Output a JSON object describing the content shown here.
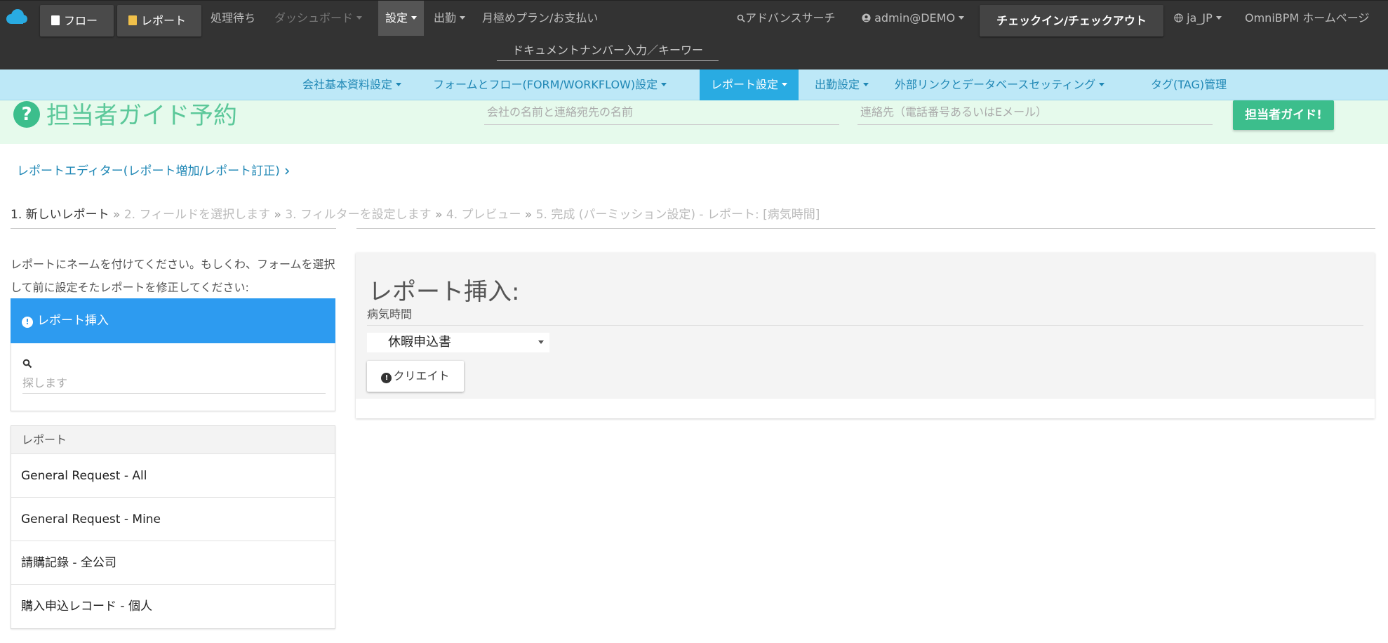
{
  "topbar": {
    "flow_button": "フロー",
    "report_button": "レポート",
    "pending": "処理待ち",
    "dashboard": "ダッシュボード",
    "settings": "設定",
    "attendance": "出勤",
    "plan": "月極めプラン/お支払い",
    "advanced_search": "アドバンスサーチ",
    "account": "admin@DEMO",
    "checkin": "チェックイン/チェックアウト",
    "language": "ja_JP",
    "homepage": "OmniBPM ホームページ",
    "doc_search_placeholder": "ドキュメントナンバー入力／キーワー"
  },
  "subnav": {
    "items": [
      "会社基本資料設定",
      "フォームとフロー(FORM/WORKFLOW)設定",
      "レポート設定",
      "出勤設定",
      "外部リンクとデータベースセッティング",
      "タグ(TAG)管理"
    ]
  },
  "guide": {
    "title": "担当者ガイド予約",
    "company_placeholder": "会社の名前と連絡宛先の名前",
    "contact_placeholder": "連絡先（電話番号あるいはEメール）",
    "button": "担当者ガイド!"
  },
  "breadcrumb": "レポートエディター(レポート増加/レポート訂正)",
  "steps": {
    "s1": "1. 新しいレポート",
    "s2": "2. フィールドを選択します",
    "s3": "3. フィルターを設定します",
    "s4": "4. プレビュー",
    "s5": "5. 完成 (パーミッション設定) - レポート: [病気時間]",
    "separator": "»"
  },
  "left": {
    "instruction": "レポートにネームを付けてください。もしくわ、フォームを選択して前に設定そたレポートを修正してください:",
    "insert_label": "レポート挿入",
    "search_placeholder": "探します",
    "reports_header": "レポート",
    "reports": [
      "General Request - All",
      "General Request - Mine",
      "請購記錄 - 全公司",
      "購入申込レコード - 個人"
    ]
  },
  "card": {
    "title": "レポート挿入:",
    "report_name": "病気時間",
    "form_select": "休暇申込書",
    "create_button": "クリエイト"
  },
  "colors": {
    "topbar": "#333333",
    "subnav": "#bde8f7",
    "accent_blue": "#2d9bf0",
    "guide_green": "#3cbe8c"
  }
}
